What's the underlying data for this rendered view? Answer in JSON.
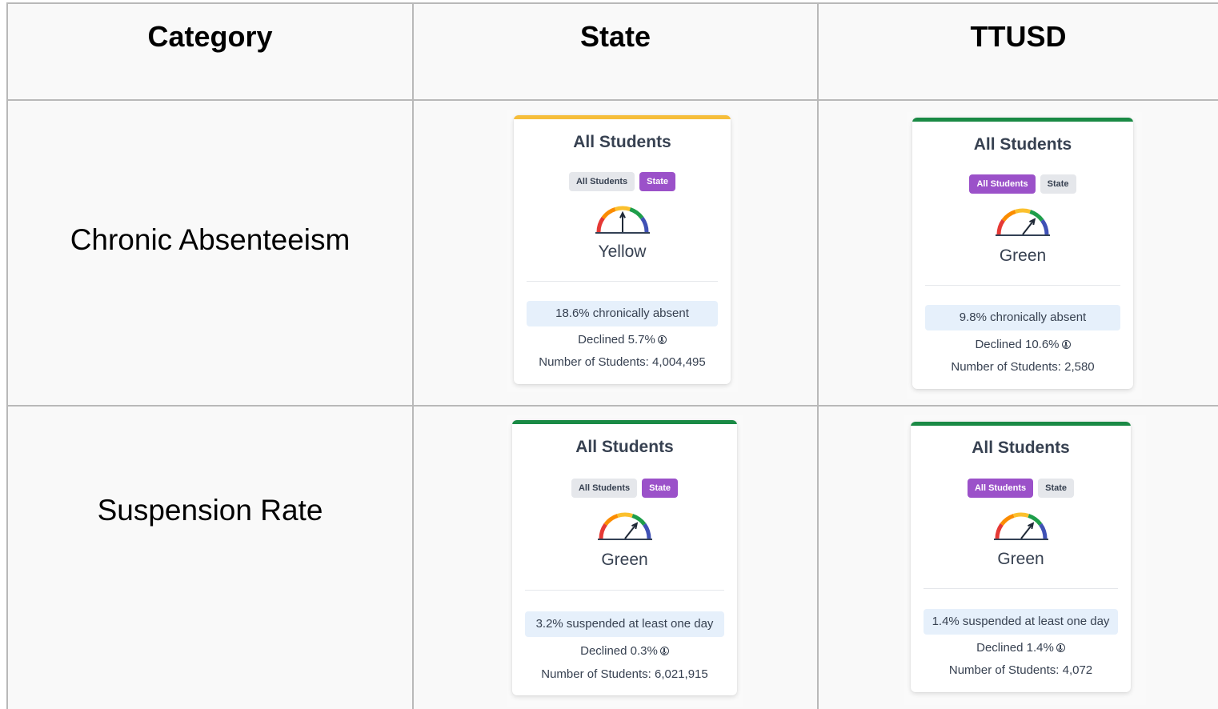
{
  "headers": {
    "category": "Category",
    "state": "State",
    "district": "TTUSD"
  },
  "colors": {
    "yellow": "#f6be3b",
    "green": "#1a8a45",
    "toggle_active": "#9b51c9",
    "metric_bg": "#e6f0fb"
  },
  "rows": [
    {
      "category": "Chronic Absenteeism",
      "state": {
        "title": "All Students",
        "toggle_all": "All Students",
        "toggle_state": "State",
        "active_toggle": "State",
        "gauge_icon": "gauge-yellow-icon",
        "status": "Yellow",
        "metric": "18.6% chronically absent",
        "change": "Declined 5.7%",
        "students": "Number of Students: 4,004,495"
      },
      "district": {
        "title": "All Students",
        "toggle_all": "All Students",
        "toggle_state": "State",
        "active_toggle": "All Students",
        "gauge_icon": "gauge-green-icon",
        "status": "Green",
        "metric": "9.8% chronically absent",
        "change": "Declined 10.6%",
        "students": "Number of Students: 2,580"
      }
    },
    {
      "category": "Suspension Rate",
      "state": {
        "title": "All Students",
        "toggle_all": "All Students",
        "toggle_state": "State",
        "active_toggle": "State",
        "gauge_icon": "gauge-green-icon",
        "status": "Green",
        "metric": "3.2% suspended at least one day",
        "change": "Declined 0.3%",
        "students": "Number of Students: 6,021,915"
      },
      "district": {
        "title": "All Students",
        "toggle_all": "All Students",
        "toggle_state": "State",
        "active_toggle": "All Students",
        "gauge_icon": "gauge-green-icon",
        "status": "Green",
        "metric": "1.4% suspended at least one day",
        "change": "Declined 1.4%",
        "students": "Number of Students: 4,072"
      }
    }
  ]
}
